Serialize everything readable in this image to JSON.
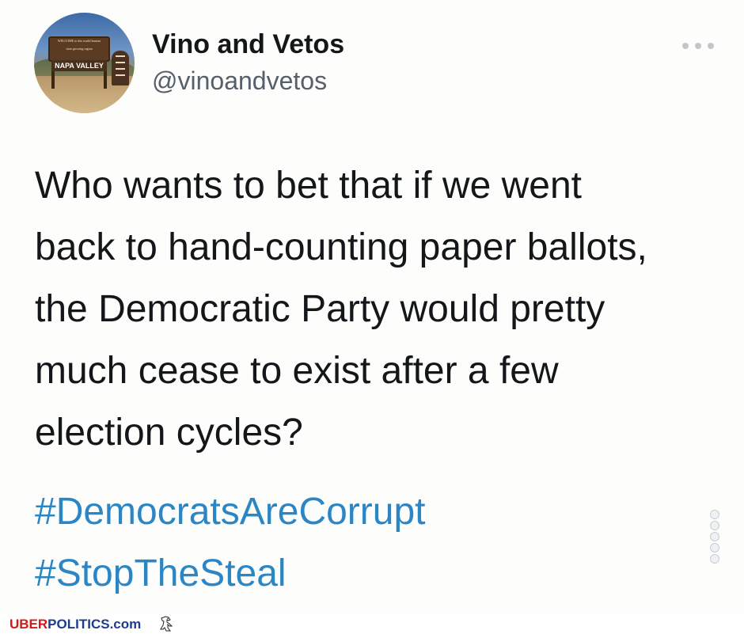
{
  "user": {
    "display_name": "Vino and Vetos",
    "handle": "@vinoandvetos",
    "avatar": {
      "sign_line_1": "WELCOME to this world famous",
      "sign_line_2": "wine growing region",
      "sign_main": "NAPA VALLEY"
    }
  },
  "tweet": {
    "text": "Who wants to bet that if we went\nback to hand-counting paper ballots,\nthe Democratic Party would pretty\nmuch cease to exist after a few\nelection cycles?",
    "hashtags": [
      "#DemocratsAreCorrupt",
      "#StopTheSteal"
    ]
  },
  "watermark": {
    "brand_part_1": "UBER",
    "brand_part_2": "POLITICS.com"
  },
  "icons": {
    "more": "more-dots-icon",
    "eagle": "eagle-icon",
    "share": [
      "facebook-icon",
      "twitter-icon",
      "pinterest-icon",
      "reddit-icon",
      "email-icon"
    ]
  },
  "colors": {
    "hashtag": "#2b86c5",
    "text": "#14171a",
    "handle": "#55606b",
    "brand_red": "#d11a1a",
    "brand_blue": "#1d3c8c"
  }
}
